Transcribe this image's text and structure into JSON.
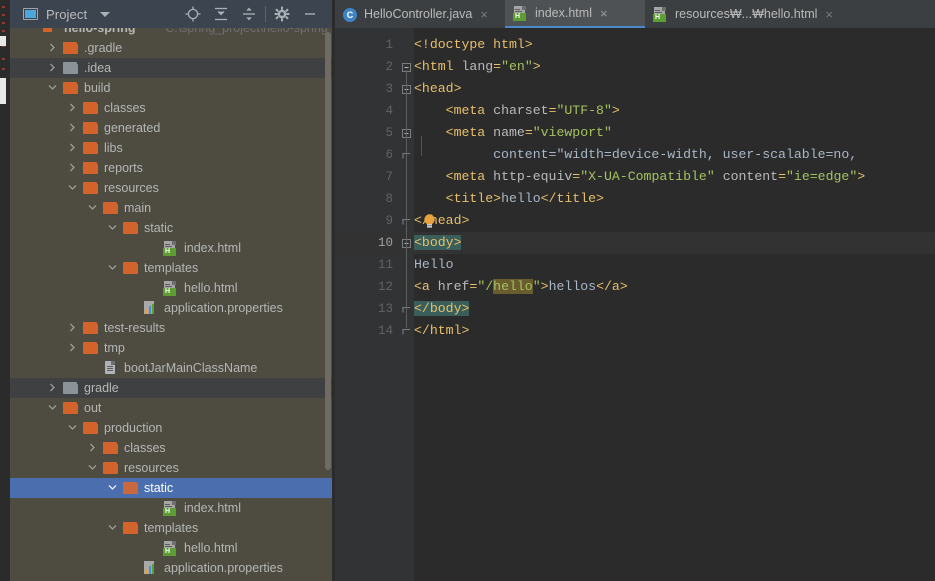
{
  "panel": {
    "title": "Project",
    "icon": "project-window-icon",
    "caret": "chevron-down-icon",
    "tools": [
      {
        "name": "locate-icon",
        "label": "Select Opened File"
      },
      {
        "name": "expand-all-icon",
        "label": "Expand All"
      },
      {
        "name": "collapse-all-icon",
        "label": "Collapse All"
      },
      {
        "name": "gear-icon",
        "label": "Settings"
      },
      {
        "name": "minimize-icon",
        "label": "Hide"
      }
    ]
  },
  "tree": [
    {
      "label": "hello-spring",
      "secondary": "C:\\spring_project\\hello-spring",
      "icon": "module-icon",
      "indent": 0,
      "arrow": "none",
      "bg": "header",
      "clipped": true
    },
    {
      "label": ".gradle",
      "icon": "folder-orange",
      "indent": 1,
      "arrow": "collapsed",
      "bg": "excluded"
    },
    {
      "label": ".idea",
      "icon": "folder-grey",
      "indent": 1,
      "arrow": "collapsed",
      "bg": "dark"
    },
    {
      "label": "build",
      "icon": "folder-orange",
      "indent": 1,
      "arrow": "expanded",
      "bg": "excluded"
    },
    {
      "label": "classes",
      "icon": "folder-orange",
      "indent": 2,
      "arrow": "collapsed",
      "bg": "excluded"
    },
    {
      "label": "generated",
      "icon": "folder-orange",
      "indent": 2,
      "arrow": "collapsed",
      "bg": "excluded"
    },
    {
      "label": "libs",
      "icon": "folder-orange",
      "indent": 2,
      "arrow": "collapsed",
      "bg": "excluded"
    },
    {
      "label": "reports",
      "icon": "folder-orange",
      "indent": 2,
      "arrow": "collapsed",
      "bg": "excluded"
    },
    {
      "label": "resources",
      "icon": "folder-orange",
      "indent": 2,
      "arrow": "expanded",
      "bg": "excluded"
    },
    {
      "label": "main",
      "icon": "folder-orange",
      "indent": 3,
      "arrow": "expanded",
      "bg": "excluded"
    },
    {
      "label": "static",
      "icon": "folder-orange",
      "indent": 4,
      "arrow": "expanded",
      "bg": "excluded"
    },
    {
      "label": "index.html",
      "icon": "html-file",
      "indent": 6,
      "arrow": "none",
      "bg": "excluded"
    },
    {
      "label": "templates",
      "icon": "folder-orange",
      "indent": 4,
      "arrow": "expanded",
      "bg": "excluded"
    },
    {
      "label": "hello.html",
      "icon": "html-file",
      "indent": 6,
      "arrow": "none",
      "bg": "excluded"
    },
    {
      "label": "application.properties",
      "icon": "properties-file",
      "indent": 5,
      "arrow": "none",
      "bg": "excluded"
    },
    {
      "label": "test-results",
      "icon": "folder-orange",
      "indent": 2,
      "arrow": "collapsed",
      "bg": "excluded"
    },
    {
      "label": "tmp",
      "icon": "folder-orange",
      "indent": 2,
      "arrow": "collapsed",
      "bg": "excluded"
    },
    {
      "label": "bootJarMainClassName",
      "icon": "plain-file",
      "indent": 3,
      "arrow": "none",
      "bg": "excluded"
    },
    {
      "label": "gradle",
      "icon": "folder-grey",
      "indent": 1,
      "arrow": "collapsed",
      "bg": "dark"
    },
    {
      "label": "out",
      "icon": "folder-orange",
      "indent": 1,
      "arrow": "expanded",
      "bg": "excluded"
    },
    {
      "label": "production",
      "icon": "folder-orange",
      "indent": 2,
      "arrow": "expanded",
      "bg": "excluded"
    },
    {
      "label": "classes",
      "icon": "folder-orange",
      "indent": 3,
      "arrow": "collapsed",
      "bg": "excluded"
    },
    {
      "label": "resources",
      "icon": "folder-orange",
      "indent": 3,
      "arrow": "expanded",
      "bg": "excluded"
    },
    {
      "label": "static",
      "icon": "folder-orange",
      "indent": 4,
      "arrow": "expanded",
      "bg": "selected"
    },
    {
      "label": "index.html",
      "icon": "html-file",
      "indent": 6,
      "arrow": "none",
      "bg": "excluded"
    },
    {
      "label": "templates",
      "icon": "folder-orange",
      "indent": 4,
      "arrow": "expanded",
      "bg": "excluded"
    },
    {
      "label": "hello.html",
      "icon": "html-file",
      "indent": 6,
      "arrow": "none",
      "bg": "excluded"
    },
    {
      "label": "application.properties",
      "icon": "properties-file",
      "indent": 5,
      "arrow": "none",
      "bg": "excluded"
    }
  ],
  "tabs": [
    {
      "label": "HelloController.java",
      "icon": "java-class-icon",
      "active": false,
      "close": "×"
    },
    {
      "label": "index.html",
      "icon": "html-file-icon",
      "active": true,
      "close": "×"
    },
    {
      "label": "resources₩...₩hello.html",
      "icon": "html-file-icon",
      "active": false,
      "close": "×"
    }
  ],
  "editor": {
    "current_line": 10,
    "lines": [
      {
        "n": "1",
        "fold": "none"
      },
      {
        "n": "2",
        "fold": "open"
      },
      {
        "n": "3",
        "fold": "open"
      },
      {
        "n": "4",
        "fold": "none"
      },
      {
        "n": "5",
        "fold": "open"
      },
      {
        "n": "6",
        "fold": "end"
      },
      {
        "n": "7",
        "fold": "none"
      },
      {
        "n": "8",
        "fold": "none"
      },
      {
        "n": "9",
        "fold": "end"
      },
      {
        "n": "10",
        "fold": "open"
      },
      {
        "n": "11",
        "fold": "none"
      },
      {
        "n": "12",
        "fold": "none"
      },
      {
        "n": "13",
        "fold": "end"
      },
      {
        "n": "14",
        "fold": "end"
      }
    ],
    "code": [
      "<!doctype html>",
      "<html lang=\"en\">",
      "<head>",
      "    <meta charset=\"UTF-8\">",
      "    <meta name=\"viewport\"",
      "          content=\"width=device-width, user-scalable=no,",
      "    <meta http-equiv=\"X-UA-Compatible\" content=\"ie=edge\">",
      "    <title>hello</title>",
      "</head>",
      "<body>",
      "Hello",
      "<a href=\"/hello\">hellos</a>",
      "</body>",
      "</html>"
    ],
    "search_highlight": "hello",
    "matching_tag_highlight": [
      "<body>",
      "</body>"
    ],
    "intention_bulb_line": 9
  },
  "colors": {
    "tag": "#E8BF6A",
    "attr_value": "#A5C261",
    "attr_name": "#BABABA",
    "text": "#A9B7C6",
    "selection": "#4B6EAF",
    "excluded_bg": "#4E4B41",
    "editor_bg": "#2B2B2B",
    "match_highlight": "#3A5F5A",
    "search_highlight": "#695D2E"
  }
}
